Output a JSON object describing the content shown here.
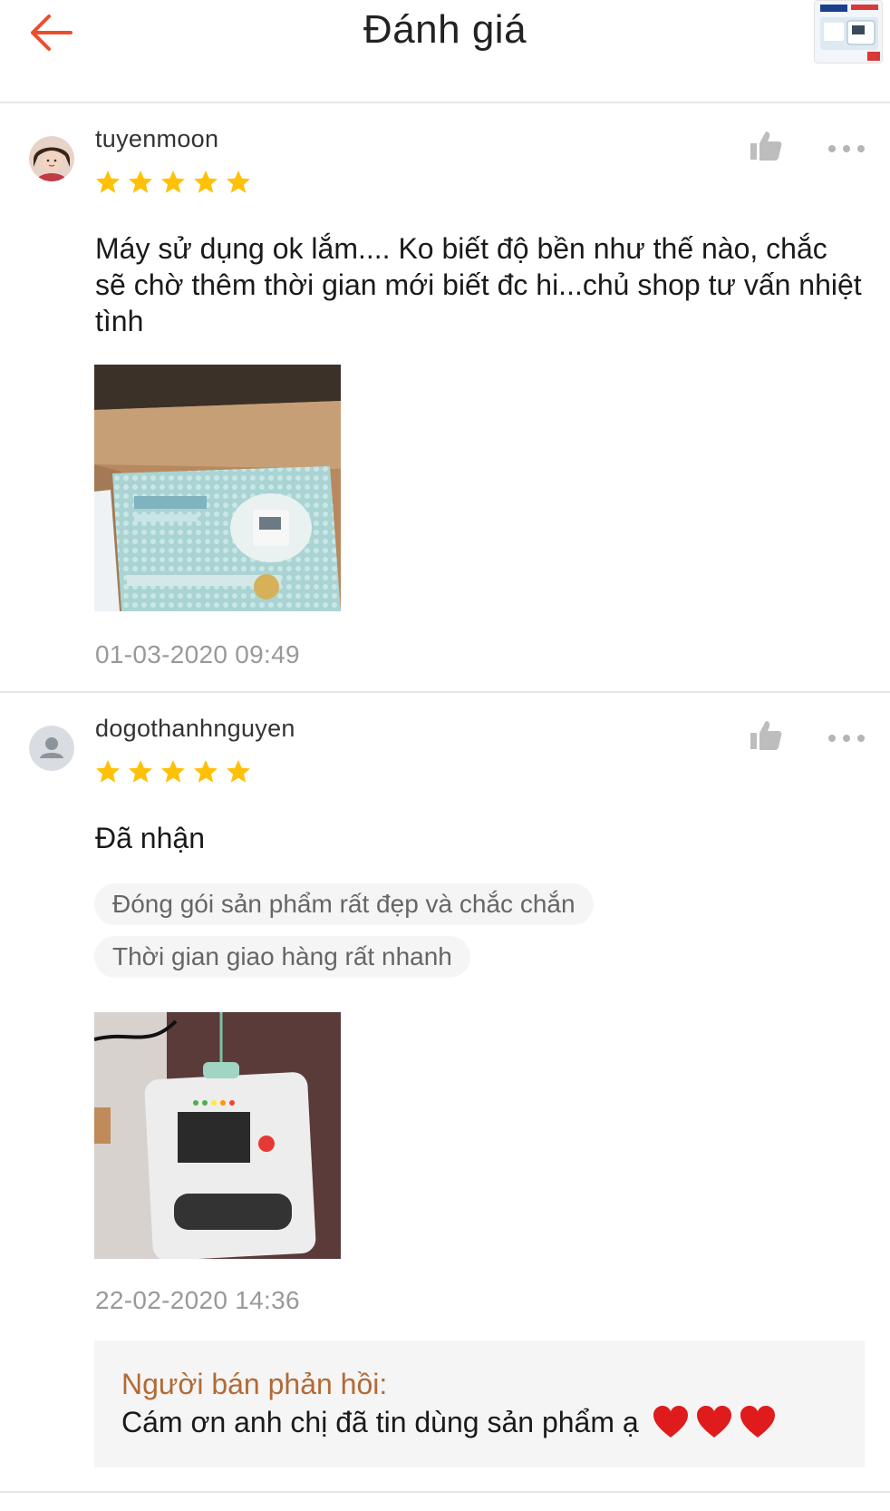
{
  "header": {
    "title": "Đánh giá",
    "back_icon": "arrow-left-icon",
    "accent_color": "#ee4d2d"
  },
  "reviews": [
    {
      "username": "tuyenmoon",
      "rating": 5,
      "text": "Máy sử dụng ok lắm.... Ko biết độ bền như thế nào, chắc sẽ chờ thêm thời gian mới biết đc hi...chủ shop tư vấn nhiệt tình",
      "timestamp": "01-03-2020 09:49",
      "tags": []
    },
    {
      "username": "dogothanhnguyen",
      "rating": 5,
      "text": "Đã nhận",
      "tags": [
        "Đóng gói sản phẩm rất đẹp và chắc chắn",
        "Thời gian giao hàng rất nhanh"
      ],
      "timestamp": "22-02-2020 14:36",
      "seller_reply": {
        "label": "Người bán phản hồi:",
        "text": "Cám ơn anh chị đã tin dùng sản phẩm ạ",
        "emoji": "heart-icon",
        "emoji_count": 3
      }
    }
  ],
  "colors": {
    "star": "#ffc107",
    "seller_label": "#b26a36",
    "timestamp": "#999999",
    "heart": "#e01b1b"
  }
}
